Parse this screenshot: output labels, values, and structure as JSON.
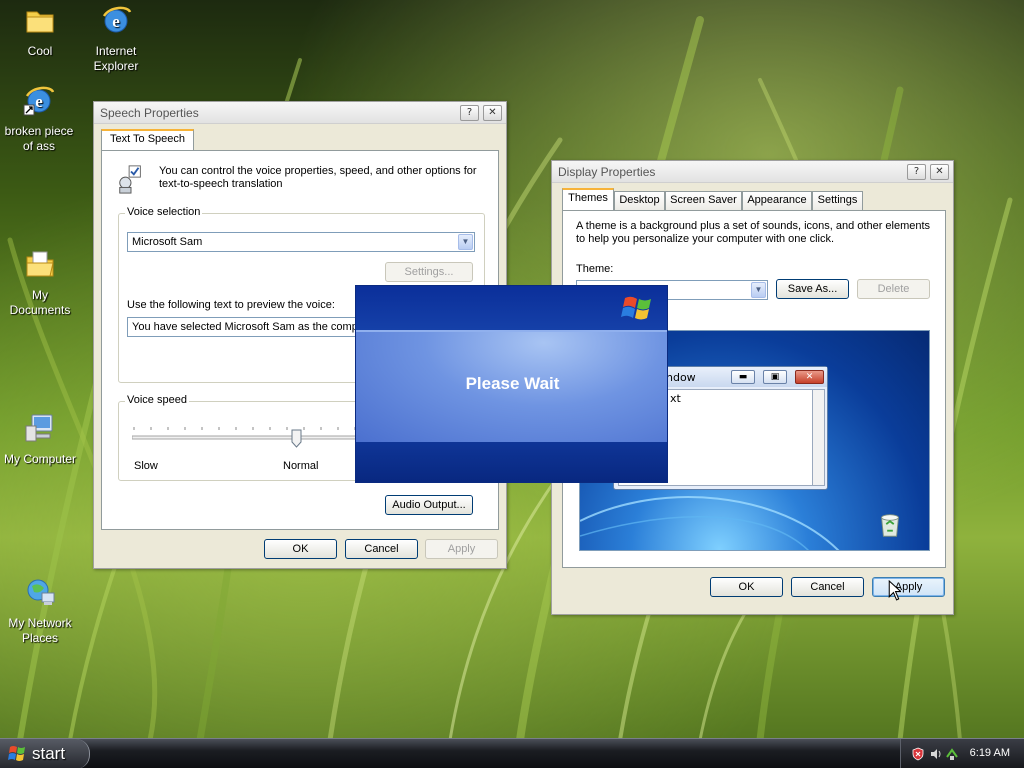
{
  "desktop": {
    "icons": [
      {
        "label": "Cool",
        "icon": "folder-icon"
      },
      {
        "label": "Internet Explorer",
        "icon": "internet-explorer-icon"
      },
      {
        "label": "broken piece of ass",
        "icon": "internet-explorer-shortcut-icon"
      },
      {
        "label": "My Documents",
        "icon": "my-documents-icon"
      },
      {
        "label": "My Computer",
        "icon": "my-computer-icon"
      },
      {
        "label": "My Network Places",
        "icon": "my-network-places-icon"
      }
    ]
  },
  "speech": {
    "title": "Speech Properties",
    "help": "?",
    "close": "✕",
    "tab": "Text To Speech",
    "intro": "You can control the voice properties, speed, and other options for text-to-speech translation",
    "voice_group": "Voice selection",
    "voice_selected": "Microsoft Sam",
    "settings_btn": "Settings...",
    "preview_label": "Use the following text to preview the voice:",
    "preview_text": "You have selected Microsoft Sam as the compu",
    "speed_group": "Voice speed",
    "speed_slow": "Slow",
    "speed_normal": "Normal",
    "audio_output": "Audio Output...",
    "ok": "OK",
    "cancel": "Cancel",
    "apply": "Apply"
  },
  "display": {
    "title": "Display Properties",
    "help": "?",
    "close": "✕",
    "tabs": [
      "Themes",
      "Desktop",
      "Screen Saver",
      "Appearance",
      "Settings"
    ],
    "desc": "A theme is a background plus a set of sounds, icons, and other elements to help you personalize your computer with one click.",
    "theme_label": "Theme:",
    "theme_value": "",
    "save_as": "Save As...",
    "delete": "Delete",
    "preview_window_title": "ndow",
    "preview_window_text": "xt",
    "ok": "OK",
    "cancel": "Cancel",
    "apply": "Apply"
  },
  "splash": {
    "message": "Please Wait"
  },
  "taskbar": {
    "start": "start",
    "clock": "6:19 AM"
  },
  "colors": {
    "xp_blue": "#0b2f9a",
    "button_border": "#003c74",
    "window_face": "#ece9d8"
  }
}
